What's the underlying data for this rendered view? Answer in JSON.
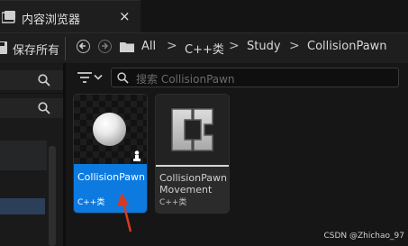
{
  "window": {
    "tab_title": "内容浏览器",
    "close_glyph": "×"
  },
  "toolbar": {
    "save_all_label": "保存所有",
    "breadcrumbs": [
      "All",
      "C++类",
      "Study",
      "CollisionPawn"
    ],
    "separator": ">"
  },
  "search": {
    "placeholder": "搜索 CollisionPawn"
  },
  "assets": [
    {
      "name": "CollisionPawn",
      "type": "C++类",
      "selected": true,
      "icon": "white-sphere-thumbnail"
    },
    {
      "name_line1": "CollisionPawn",
      "name_line2": "Movement",
      "type": "C++类",
      "selected": false,
      "icon": "cpp-class-c-icon"
    }
  ],
  "watermark": "CSDN @Zhichao_97",
  "colors": {
    "selection": "#0d7adf",
    "background": "#151515",
    "annotation_arrow": "#d93a1f"
  }
}
